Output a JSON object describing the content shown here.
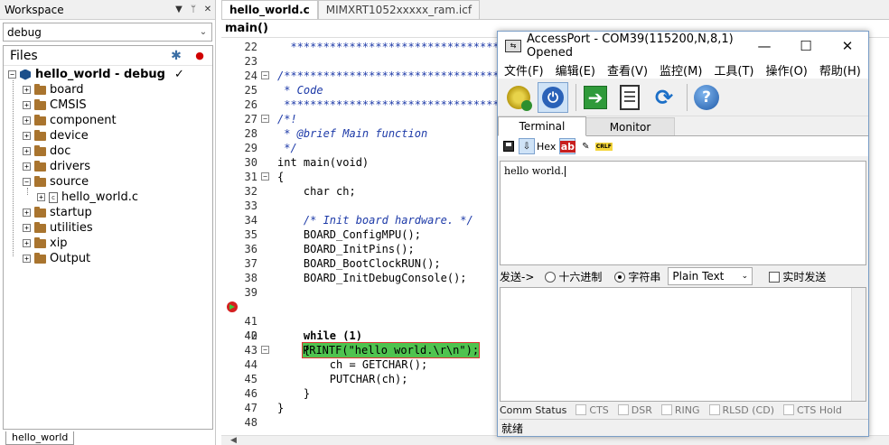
{
  "workspace": {
    "title": "Workspace",
    "config": "debug",
    "files_label": "Files",
    "project": "hello_world - debug",
    "project_check": "✓",
    "folders": [
      "board",
      "CMSIS",
      "component",
      "device",
      "doc",
      "drivers",
      "source",
      "startup",
      "utilities",
      "xip",
      "Output"
    ],
    "source_file": "hello_world.c",
    "bottom_tab": "hello_world"
  },
  "editor": {
    "tabs": [
      "hello_world.c",
      "MIMXRT1052xxxxx_ram.icf"
    ],
    "func_bar": "main()",
    "lines": [
      {
        "n": "22",
        "text": "  **************************************"
      },
      {
        "n": "23",
        "text": ""
      },
      {
        "n": "24",
        "text": "/****************************************"
      },
      {
        "n": "25",
        "text": " * Code"
      },
      {
        "n": "26",
        "text": " ****************************************"
      },
      {
        "n": "27",
        "text": "/*!"
      },
      {
        "n": "28",
        "text": " * @brief Main function"
      },
      {
        "n": "29",
        "text": " */"
      },
      {
        "n": "30",
        "text": "int main(void)"
      },
      {
        "n": "31",
        "text": "{"
      },
      {
        "n": "32",
        "text": "    char ch;"
      },
      {
        "n": "33",
        "text": ""
      },
      {
        "n": "34",
        "text": "    /* Init board hardware. */"
      },
      {
        "n": "35",
        "text": "    BOARD_ConfigMPU();"
      },
      {
        "n": "36",
        "text": "    BOARD_InitPins();"
      },
      {
        "n": "37",
        "text": "    BOARD_BootClockRUN();"
      },
      {
        "n": "38",
        "text": "    BOARD_InitDebugConsole();"
      },
      {
        "n": "39",
        "text": ""
      },
      {
        "n": "40",
        "text": "PRINTF(\"hello world.\\r\\n\");"
      },
      {
        "n": "41",
        "text": ""
      },
      {
        "n": "42",
        "text": "    while (1)"
      },
      {
        "n": "43",
        "text": "    {"
      },
      {
        "n": "44",
        "text": "        ch = GETCHAR();"
      },
      {
        "n": "45",
        "text": "        PUTCHAR(ch);"
      },
      {
        "n": "46",
        "text": "    }"
      },
      {
        "n": "47",
        "text": "}"
      },
      {
        "n": "48",
        "text": ""
      }
    ],
    "breakpoint_line": "40"
  },
  "accessport": {
    "title": "AccessPort - COM39(115200,N,8,1) Opened",
    "menu": [
      "文件(F)",
      "编辑(E)",
      "查看(V)",
      "监控(M)",
      "工具(T)",
      "操作(O)",
      "帮助(H)"
    ],
    "toolbar_icons": [
      "settings-icon",
      "power-icon",
      "forward-arrow-icon",
      "document-icon",
      "refresh-icon",
      "help-icon"
    ],
    "tabs": [
      "Terminal",
      "Monitor"
    ],
    "terminal_toolbar": {
      "hex": "Hex",
      "ab": "ab",
      "crlf": "CRLF"
    },
    "received_text": "hello world.",
    "send_label": "发送->",
    "radio_hex": "十六进制",
    "radio_string": "字符串",
    "send_format": "Plain Text",
    "realtime_send": "实时发送",
    "comm_status": "Comm Status",
    "signals": [
      "CTS",
      "DSR",
      "RING",
      "RLSD (CD)",
      "CTS Hold"
    ],
    "status_ready": "就绪"
  }
}
